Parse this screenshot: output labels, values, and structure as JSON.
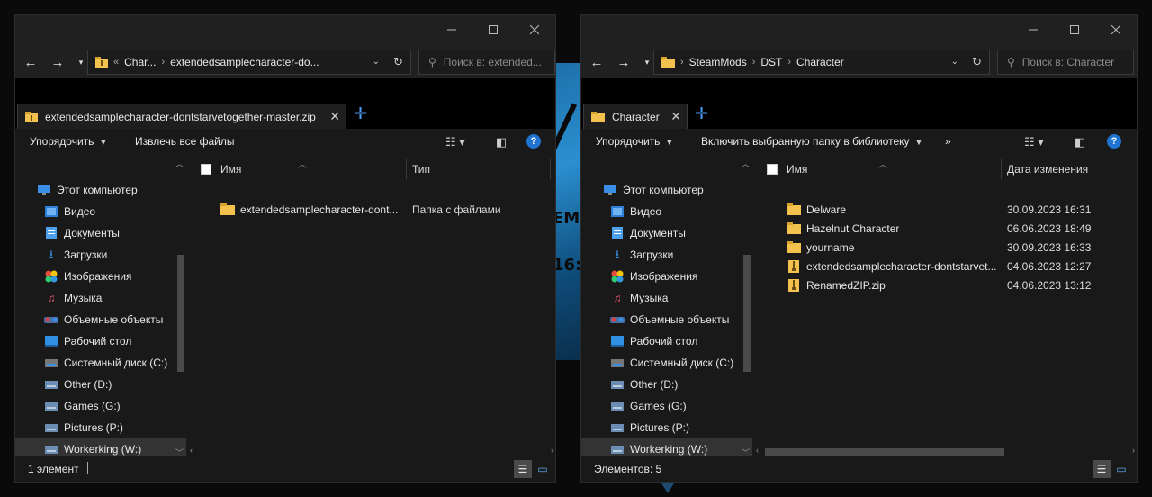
{
  "colors": {
    "accent": "#1e74d0",
    "folder": "#f2c14e",
    "folder_dark": "#d9a32c",
    "zip_badge": "#f2c14e"
  },
  "left": {
    "breadcrumb": [
      "Char...",
      "extendedsamplecharacter-do..."
    ],
    "breadcrumb_overflow": "«",
    "search_placeholder": "Поиск в: extended...",
    "tab_label": "extendedsamplecharacter-dontstarvetogether-master.zip",
    "commands": {
      "organize": "Упорядочить",
      "extract_all": "Извлечь все файлы"
    },
    "columns": {
      "name": "Имя",
      "type": "Тип"
    },
    "rows": [
      {
        "name": "extendedsamplecharacter-dont...",
        "type": "Папка с файлами"
      }
    ],
    "status": "1 элемент"
  },
  "right": {
    "breadcrumb": [
      "SteamMods",
      "DST",
      "Character"
    ],
    "search_placeholder": "Поиск в: Character",
    "tab_label": "Character",
    "commands": {
      "organize": "Упорядочить",
      "include_library": "Включить выбранную папку в библиотеку",
      "more": "»"
    },
    "columns": {
      "name": "Имя",
      "date": "Дата изменения"
    },
    "rows": [
      {
        "name": "Delware",
        "date": "30.09.2023 16:31",
        "kind": "folder"
      },
      {
        "name": "Hazelnut Character",
        "date": "06.06.2023 18:49",
        "kind": "folder"
      },
      {
        "name": "yourname",
        "date": "30.09.2023 16:33",
        "kind": "folder"
      },
      {
        "name": "extendedsamplecharacter-dontstarvet...",
        "date": "04.06.2023 12:27",
        "kind": "zip"
      },
      {
        "name": "RenamedZIP.zip",
        "date": "04.06.2023 13:12",
        "kind": "zip"
      }
    ],
    "status": "Элементов: 5"
  },
  "navpane": [
    {
      "label": "Этот компьютер",
      "icon": "computer-icon"
    },
    {
      "label": "Видео",
      "icon": "video-icon"
    },
    {
      "label": "Документы",
      "icon": "documents-icon"
    },
    {
      "label": "Загрузки",
      "icon": "downloads-icon"
    },
    {
      "label": "Изображения",
      "icon": "pictures-icon"
    },
    {
      "label": "Музыка",
      "icon": "music-icon"
    },
    {
      "label": "Объемные объекты",
      "icon": "3d-objects-icon"
    },
    {
      "label": "Рабочий стол",
      "icon": "desktop-icon"
    },
    {
      "label": "Системный диск (C:)",
      "icon": "system-drive-icon"
    },
    {
      "label": "Other (D:)",
      "icon": "drive-icon"
    },
    {
      "label": "Games (G:)",
      "icon": "drive-icon"
    },
    {
      "label": "Pictures (P:)",
      "icon": "drive-icon"
    },
    {
      "label": "Workerking (W:)",
      "icon": "drive-icon",
      "selected": true
    }
  ],
  "desktop_text": [
    "EM",
    "16:"
  ]
}
